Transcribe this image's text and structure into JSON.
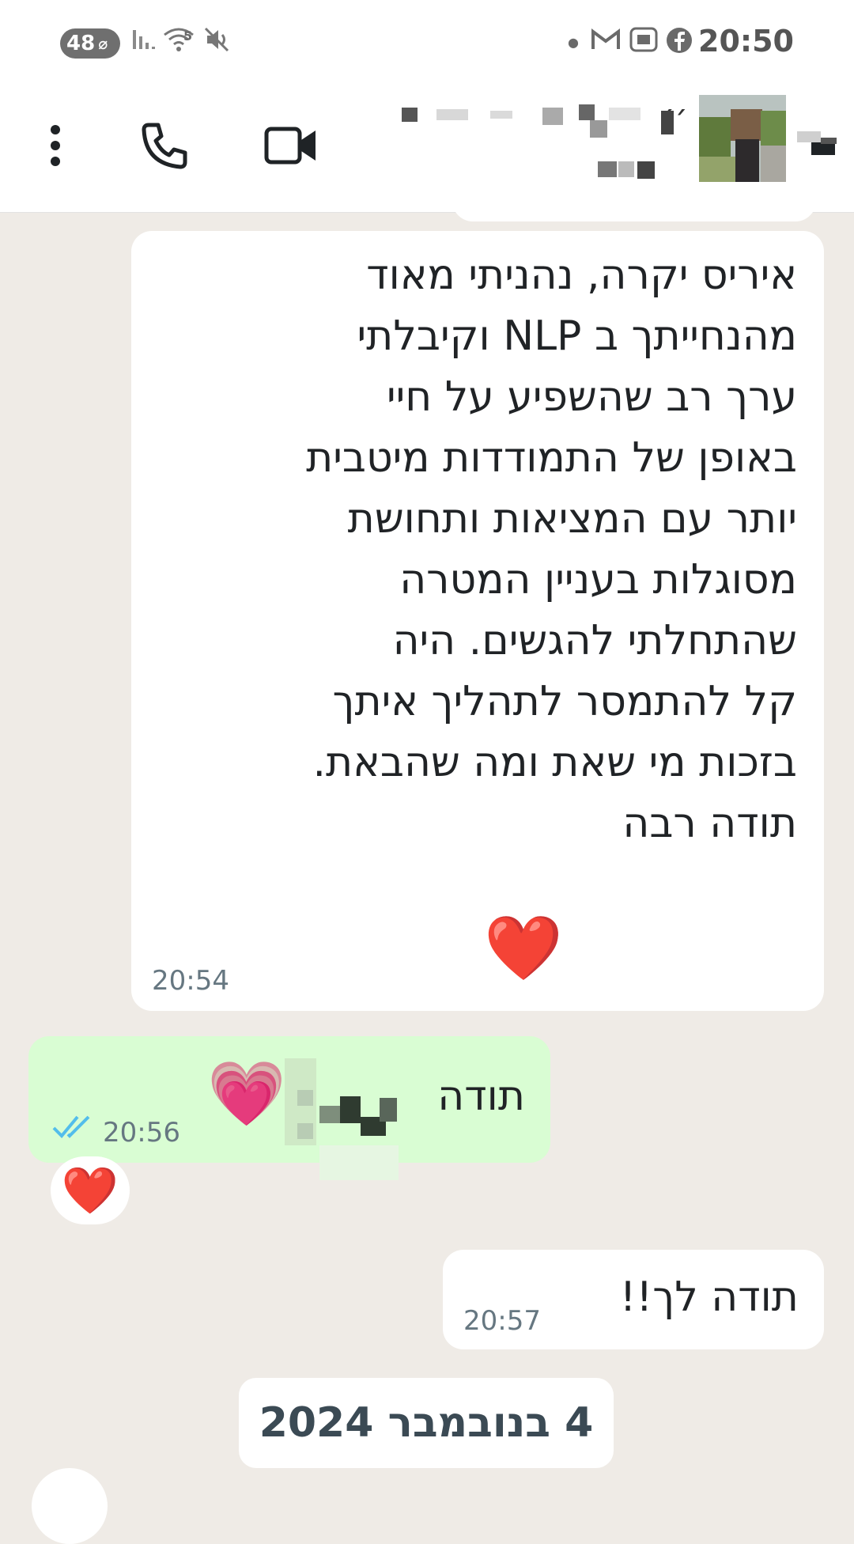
{
  "status_bar": {
    "battery": "48",
    "network": "5",
    "time": "20:50"
  },
  "header": {
    "menu_icon": "more-vert-icon",
    "call_icon": "phone-icon",
    "video_icon": "video-camera-icon",
    "contact_name_suffix": "׳׳"
  },
  "messages": [
    {
      "direction": "incoming",
      "text": "איריס יקרה, נהניתי מאוד\nמהנחייתך ב NLP וקיבלתי\nערך רב שהשפיע על חיי\nבאופן של התמודדות מיטבית\nיותר עם המציאות ותחושת\nמסוגלות בעניין המטרה\nשהתחלתי להגשים. היה\nקל להתמסר לתהליך איתך\nבזכות מי שאת ומה שהבאת.\nתודה רבה",
      "emoji": "❤️",
      "time": "20:54"
    },
    {
      "direction": "outgoing",
      "text": "תודה",
      "emoji": "💗",
      "time": "20:56",
      "status": "read",
      "reaction": "❤️"
    },
    {
      "direction": "incoming",
      "text": "תודה לך!!",
      "time": "20:57"
    }
  ],
  "date_separator": "4 בנובמבר 2024",
  "colors": {
    "chat_bg": "#efebe6",
    "incoming_bubble": "#ffffff",
    "outgoing_bubble": "#d9fdd3",
    "read_ticks": "#53bdeb"
  }
}
